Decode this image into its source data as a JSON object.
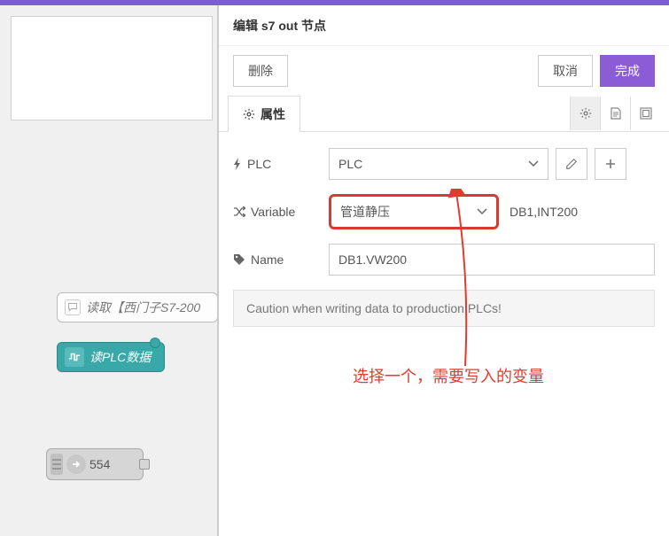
{
  "panel": {
    "title": "编辑 s7 out 节点",
    "delete_btn": "删除",
    "cancel_btn": "取消",
    "done_btn": "完成"
  },
  "tabs": {
    "properties": "属性"
  },
  "form": {
    "plc_label": "PLC",
    "plc_value": "PLC",
    "variable_label": "Variable",
    "variable_value": "管道静压",
    "variable_suffix": "DB1,INT200",
    "name_label": "Name",
    "name_value": "DB1.VW200",
    "caution": "Caution when writing data to production PLCs!"
  },
  "annotation": "选择一个，需要写入的变量",
  "canvas": {
    "fn_node": "读取【西门子S7-200",
    "plc_node": "读PLC数据",
    "num_node": "554"
  }
}
